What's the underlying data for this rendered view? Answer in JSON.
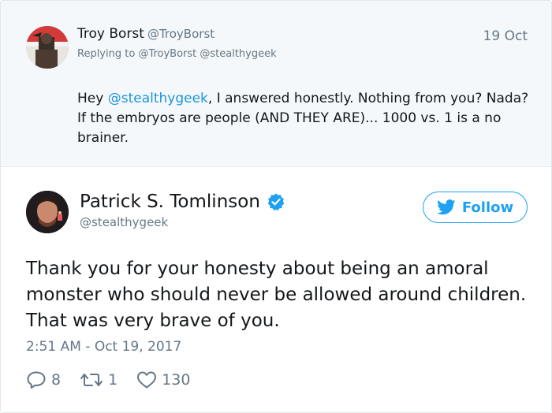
{
  "reply_tweet": {
    "name": "Troy Borst",
    "handle": "@TroyBorst",
    "date": "19 Oct",
    "replying_prefix": "Replying to",
    "replying_to": "@TroyBorst @stealthygeek",
    "text_pre": "Hey ",
    "text_mention": "@stealthygeek",
    "text_post": ", I answered honestly. Nothing from you? Nada? If the embryos are people (AND THEY ARE)... 1000 vs. 1 is a no brainer."
  },
  "main_tweet": {
    "name": "Patrick S. Tomlinson",
    "handle": "@stealthygeek",
    "follow_label": "Follow",
    "text": "Thank you for your honesty about being an amoral monster who should never be allowed around children. That was very brave of you.",
    "timestamp": "2:51 AM - Oct 19, 2017",
    "replies": "8",
    "retweets": "1",
    "likes": "130"
  },
  "colors": {
    "accent": "#1da1f2",
    "mention": "#1b95e0",
    "muted": "#657786",
    "reply_bg": "#f5f8fa"
  },
  "icons": [
    "verified-badge-icon",
    "twitter-bird-icon",
    "reply-icon",
    "retweet-icon",
    "like-heart-icon"
  ]
}
